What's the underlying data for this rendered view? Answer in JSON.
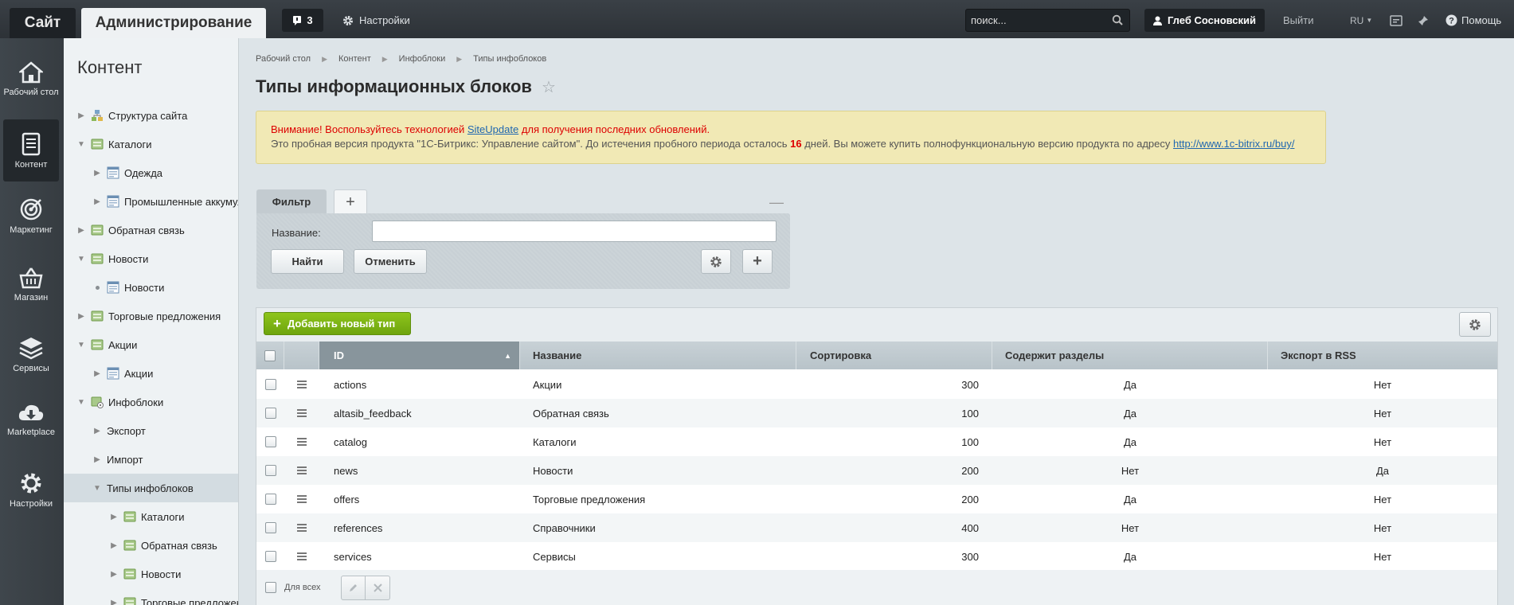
{
  "topbar": {
    "site_tab": "Сайт",
    "admin_tab": "Администрирование",
    "notify_count": "3",
    "settings_label": "Настройки",
    "search_placeholder": "поиск...",
    "user_name": "Глеб Сосновский",
    "logout_label": "Выйти",
    "lang": "RU",
    "help_label": "Помощь"
  },
  "leftmenu": {
    "items": [
      {
        "label": "Рабочий стол",
        "icon": "home-icon"
      },
      {
        "label": "Контент",
        "icon": "document-icon"
      },
      {
        "label": "Маркетинг",
        "icon": "target-icon"
      },
      {
        "label": "Магазин",
        "icon": "basket-icon"
      },
      {
        "label": "Сервисы",
        "icon": "layers-icon"
      },
      {
        "label": "Marketplace",
        "icon": "cloud-download-icon"
      },
      {
        "label": "Настройки",
        "icon": "gear-icon"
      }
    ]
  },
  "tree": {
    "title": "Контент",
    "items": [
      {
        "label": "Структура сайта"
      },
      {
        "label": "Каталоги"
      },
      {
        "label": "Одежда"
      },
      {
        "label": "Промышленные аккумуляторы"
      },
      {
        "label": "Обратная связь"
      },
      {
        "label": "Новости"
      },
      {
        "label": "Новости"
      },
      {
        "label": "Торговые предложения"
      },
      {
        "label": "Акции"
      },
      {
        "label": "Акции"
      },
      {
        "label": "Инфоблоки"
      },
      {
        "label": "Экспорт"
      },
      {
        "label": "Импорт"
      },
      {
        "label": "Типы инфоблоков"
      },
      {
        "label": "Каталоги"
      },
      {
        "label": "Обратная связь"
      },
      {
        "label": "Новости"
      },
      {
        "label": "Торговые предложения"
      }
    ]
  },
  "breadcrumb": [
    "Рабочий стол",
    "Контент",
    "Инфоблоки",
    "Типы инфоблоков"
  ],
  "page_title": "Типы информационных блоков",
  "notice": {
    "line1_pre": "Внимание! Воспользуйтесь технологией ",
    "line1_link": "SiteUpdate",
    "line1_post": " для получения последних обновлений.",
    "line2_pre": "Это пробная версия продукта \"1С-Битрикс: Управление сайтом\". До истечения пробного периода осталось ",
    "days": "16",
    "line2_mid": " дней. Вы можете купить полнофункциональную версию продукта по адресу ",
    "line2_link": "http://www.1c-bitrix.ru/buy/"
  },
  "filter": {
    "tab_label": "Фильтр",
    "name_label": "Название:",
    "name_value": "",
    "find_button": "Найти",
    "cancel_button": "Отменить"
  },
  "grid": {
    "add_button": "Добавить новый тип",
    "columns": [
      "ID",
      "Название",
      "Сортировка",
      "Содержит разделы",
      "Экспорт в RSS"
    ],
    "rows": [
      {
        "id": "actions",
        "name": "Акции",
        "sort": "300",
        "sections": "Да",
        "rss": "Нет"
      },
      {
        "id": "altasib_feedback",
        "name": "Обратная связь",
        "sort": "100",
        "sections": "Да",
        "rss": "Нет"
      },
      {
        "id": "catalog",
        "name": "Каталоги",
        "sort": "100",
        "sections": "Да",
        "rss": "Нет"
      },
      {
        "id": "news",
        "name": "Новости",
        "sort": "200",
        "sections": "Нет",
        "rss": "Да"
      },
      {
        "id": "offers",
        "name": "Торговые предложения",
        "sort": "200",
        "sections": "Да",
        "rss": "Нет"
      },
      {
        "id": "references",
        "name": "Справочники",
        "sort": "400",
        "sections": "Нет",
        "rss": "Нет"
      },
      {
        "id": "services",
        "name": "Сервисы",
        "sort": "300",
        "sections": "Да",
        "rss": "Нет"
      }
    ],
    "for_all_label": "Для всех"
  }
}
